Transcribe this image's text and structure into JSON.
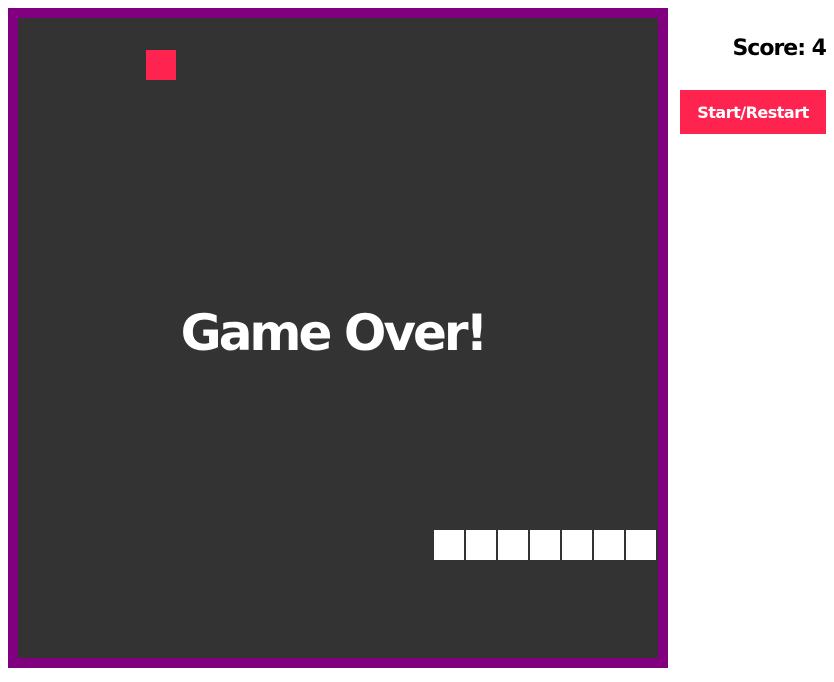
{
  "game": {
    "grid_size": 20,
    "food": {
      "col": 4,
      "row": 1
    },
    "snake": [
      {
        "col": 13,
        "row": 16
      },
      {
        "col": 14,
        "row": 16
      },
      {
        "col": 15,
        "row": 16
      },
      {
        "col": 16,
        "row": 16
      },
      {
        "col": 17,
        "row": 16
      },
      {
        "col": 18,
        "row": 16
      },
      {
        "col": 19,
        "row": 16
      }
    ],
    "status_text": "Game Over!",
    "colors": {
      "board": "#333333",
      "border": "#800080",
      "food": "#ff2450",
      "snake": "#ffffff"
    }
  },
  "panel": {
    "score_text": "Score: 4",
    "button_label": "Start/Restart"
  }
}
